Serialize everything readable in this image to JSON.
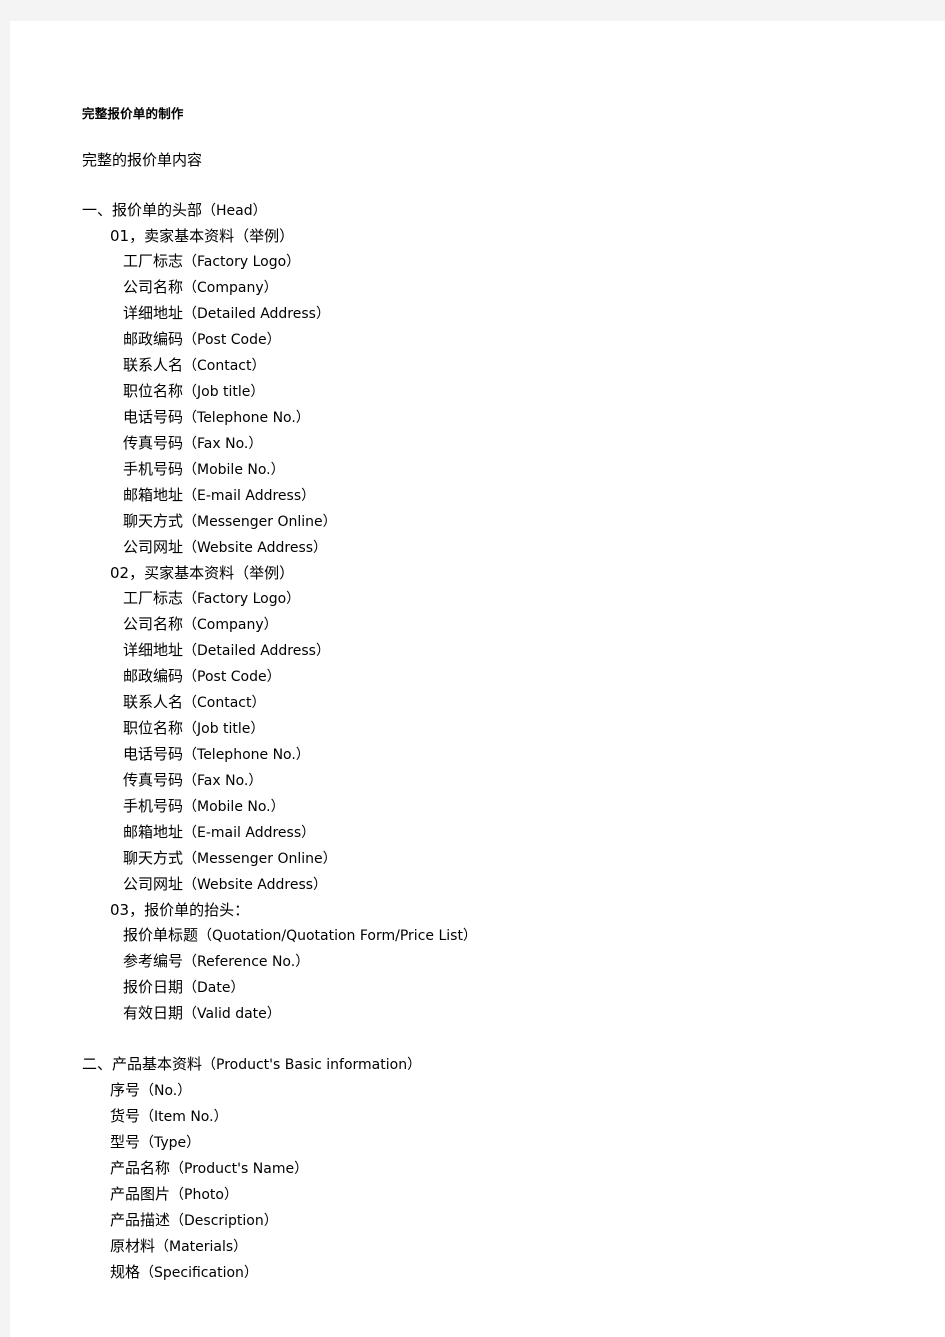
{
  "document": {
    "title": "完整报价单的制作",
    "lead": "完整的报价单内容",
    "sections": [
      {
        "id": "section-1",
        "heading_cjk": "一、报价单的头部",
        "heading_en": "（Head）",
        "groups": [
          {
            "id": "group-01",
            "label_cjk": "01，卖家基本资料",
            "label_en": "（举例）",
            "items": [
              {
                "cjk": "工厂标志",
                "en": "（Factory Logo）"
              },
              {
                "cjk": "公司名称",
                "en": "（Company）"
              },
              {
                "cjk": "详细地址",
                "en": "（Detailed Address）"
              },
              {
                "cjk": "邮政编码",
                "en": "（Post Code）"
              },
              {
                "cjk": "联系人名",
                "en": "（Contact）"
              },
              {
                "cjk": "职位名称",
                "en": "（Job title）"
              },
              {
                "cjk": "电话号码",
                "en": "（Telephone No.）"
              },
              {
                "cjk": "传真号码",
                "en": "（Fax No.）"
              },
              {
                "cjk": "手机号码",
                "en": "（Mobile No.）"
              },
              {
                "cjk": "邮箱地址",
                "en": "（E-mail Address）"
              },
              {
                "cjk": "聊天方式",
                "en": "（Messenger Online）"
              },
              {
                "cjk": "公司网址",
                "en": "（Website Address）"
              }
            ]
          },
          {
            "id": "group-02",
            "label_cjk": "02，买家基本资料",
            "label_en": "（举例）",
            "items": [
              {
                "cjk": "工厂标志",
                "en": "（Factory Logo）"
              },
              {
                "cjk": "公司名称",
                "en": "（Company）"
              },
              {
                "cjk": "详细地址",
                "en": "（Detailed Address）"
              },
              {
                "cjk": "邮政编码",
                "en": "（Post Code）"
              },
              {
                "cjk": "联系人名",
                "en": "（Contact）"
              },
              {
                "cjk": "职位名称",
                "en": "（Job title）"
              },
              {
                "cjk": "电话号码",
                "en": "（Telephone No.）"
              },
              {
                "cjk": "传真号码",
                "en": "（Fax No.）"
              },
              {
                "cjk": "手机号码",
                "en": "（Mobile No.）"
              },
              {
                "cjk": "邮箱地址",
                "en": "（E-mail Address）"
              },
              {
                "cjk": "聊天方式",
                "en": "（Messenger Online）"
              },
              {
                "cjk": "公司网址",
                "en": "（Website Address）"
              }
            ]
          },
          {
            "id": "group-03",
            "label_cjk": "03，报价单的抬头：",
            "label_en": "",
            "items": [
              {
                "cjk": "报价单标题",
                "en": "（Quotation/Quotation Form/Price List）"
              },
              {
                "cjk": "参考编号",
                "en": "（Reference No.）"
              },
              {
                "cjk": "报价日期",
                "en": "（Date）"
              },
              {
                "cjk": "有效日期",
                "en": "（Valid date）"
              }
            ]
          }
        ]
      },
      {
        "id": "section-2",
        "heading_cjk": "二、产品基本资料",
        "heading_en": "（Product's Basic information）",
        "groups": [
          {
            "id": "group-product",
            "label_cjk": "",
            "label_en": "",
            "items": [
              {
                "cjk": "序号",
                "en": "（No.）"
              },
              {
                "cjk": "货号",
                "en": "（Item No.）"
              },
              {
                "cjk": "型号",
                "en": "（Type）"
              },
              {
                "cjk": "产品名称",
                "en": "（Product's Name）"
              },
              {
                "cjk": "产品图片",
                "en": "（Photo）"
              },
              {
                "cjk": "产品描述",
                "en": "（Description）"
              },
              {
                "cjk": "原材料",
                "en": "（Materials）"
              },
              {
                "cjk": "规格",
                "en": "（Specification）"
              }
            ]
          }
        ]
      }
    ]
  }
}
